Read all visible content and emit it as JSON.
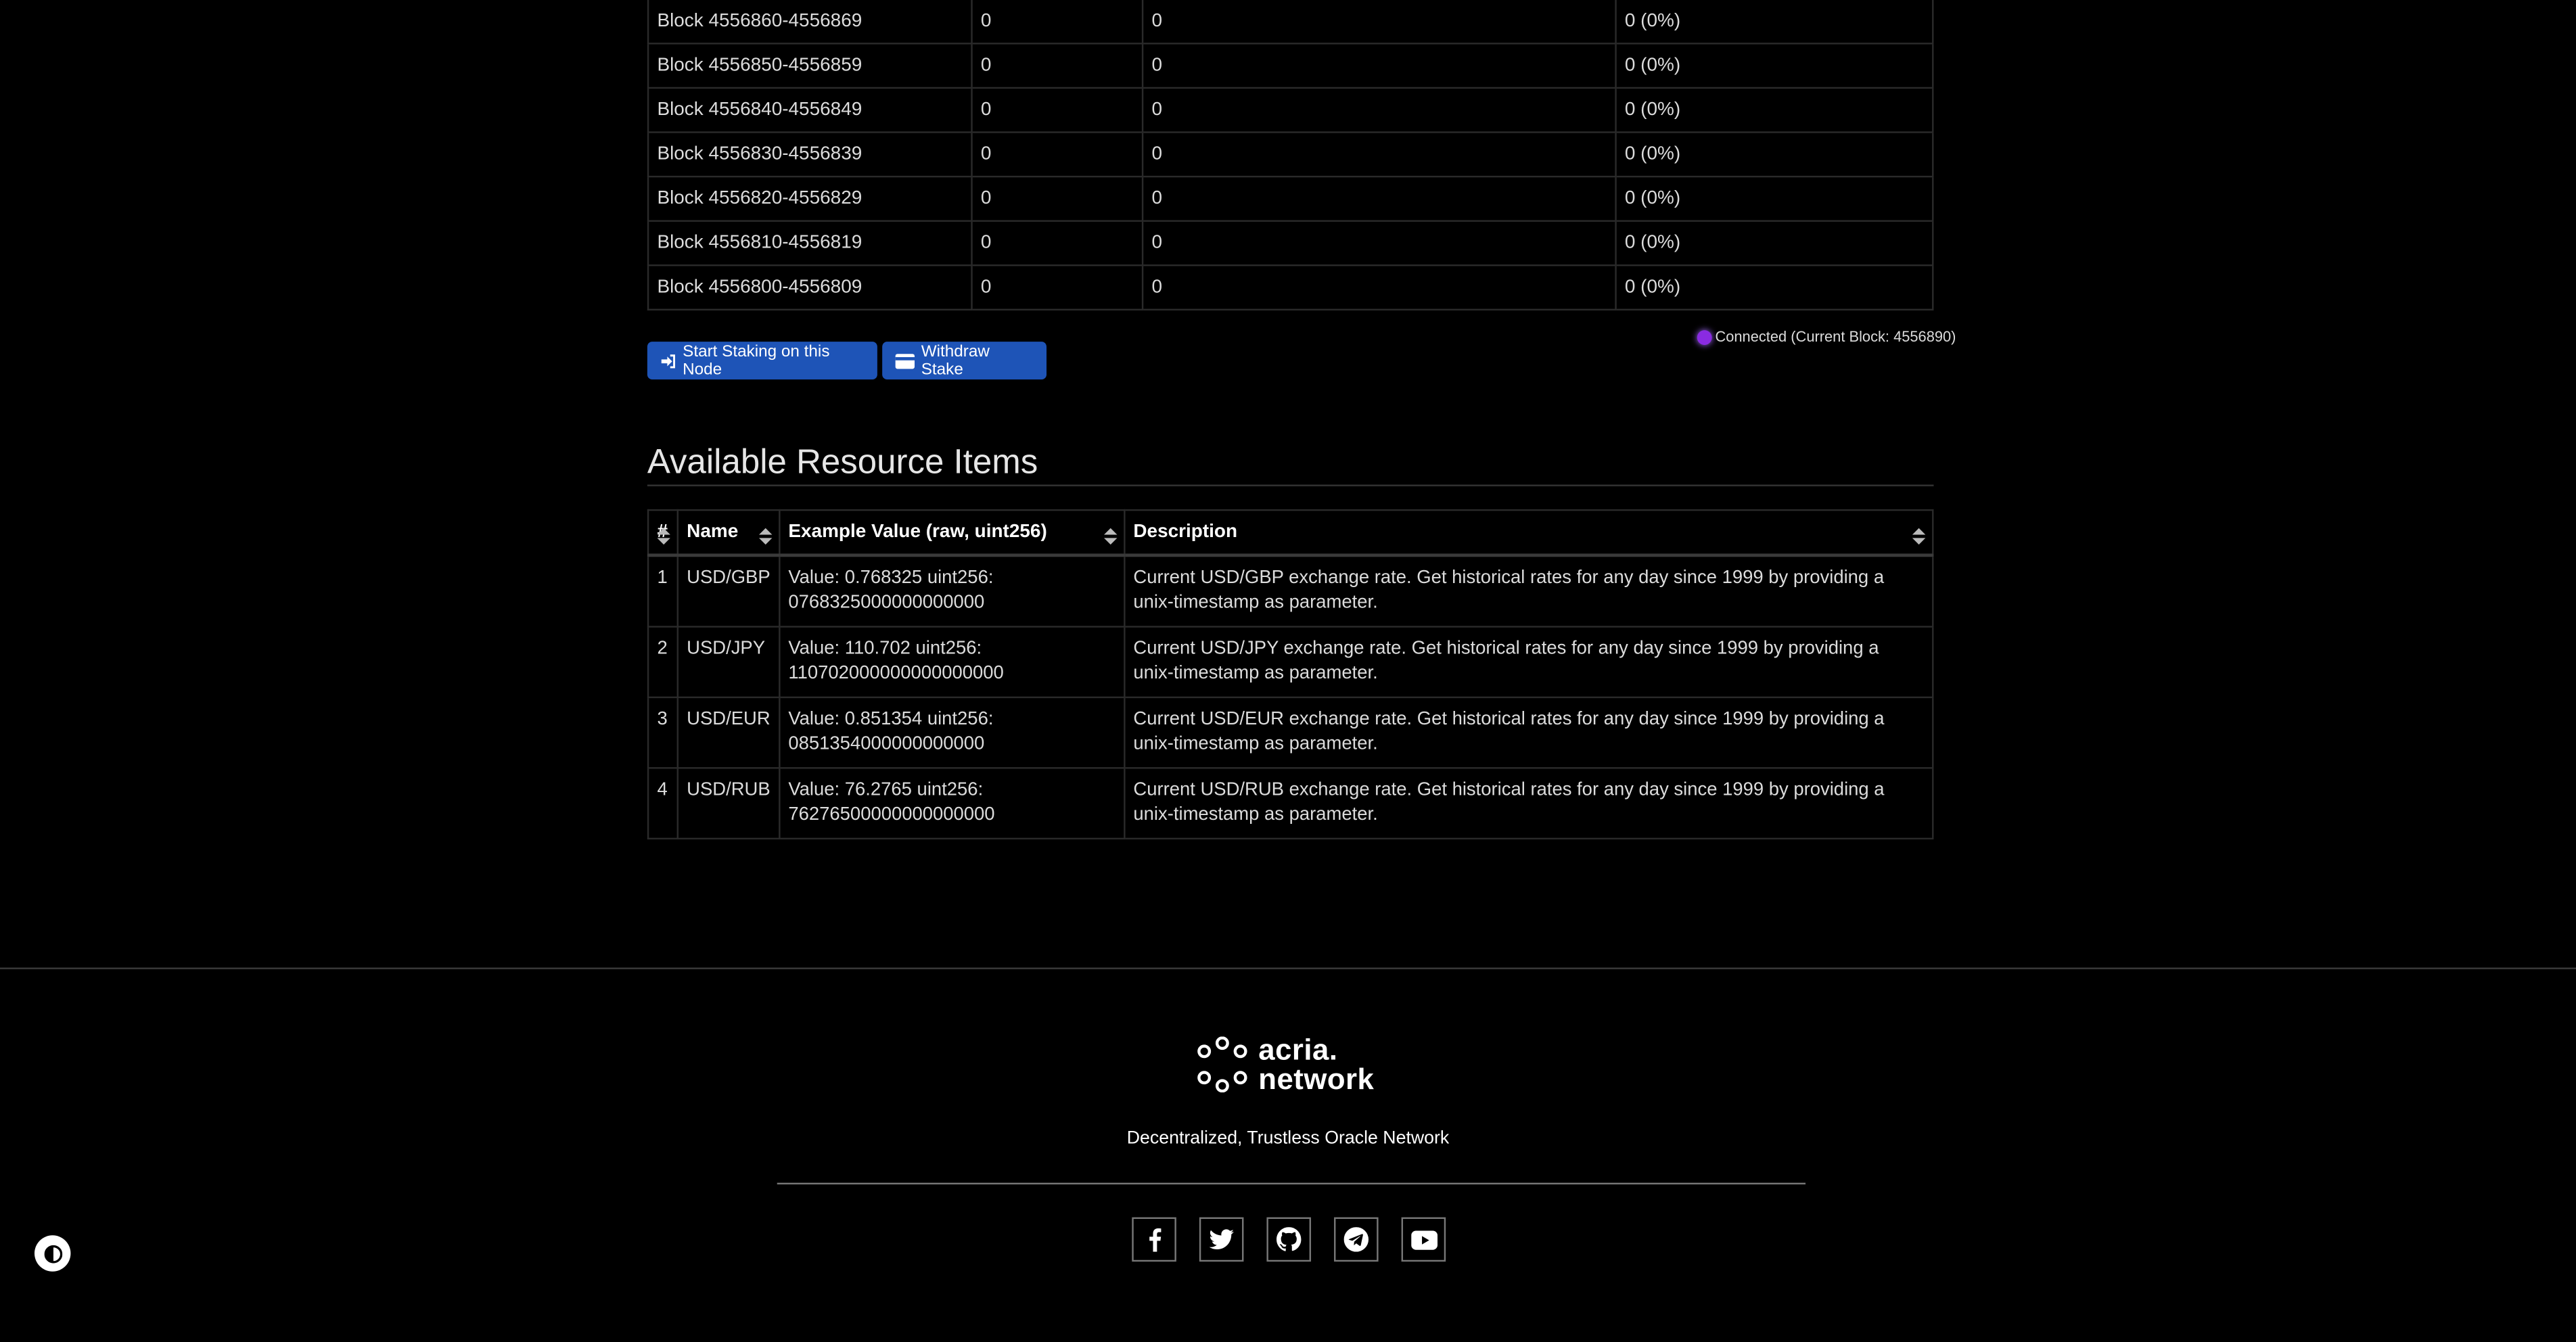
{
  "blocks": {
    "rows": [
      {
        "block": "Block 4556860-4556869",
        "c2": "0",
        "c3": "0",
        "c4": "0 (0%)"
      },
      {
        "block": "Block 4556850-4556859",
        "c2": "0",
        "c3": "0",
        "c4": "0 (0%)"
      },
      {
        "block": "Block 4556840-4556849",
        "c2": "0",
        "c3": "0",
        "c4": "0 (0%)"
      },
      {
        "block": "Block 4556830-4556839",
        "c2": "0",
        "c3": "0",
        "c4": "0 (0%)"
      },
      {
        "block": "Block 4556820-4556829",
        "c2": "0",
        "c3": "0",
        "c4": "0 (0%)"
      },
      {
        "block": "Block 4556810-4556819",
        "c2": "0",
        "c3": "0",
        "c4": "0 (0%)"
      },
      {
        "block": "Block 4556800-4556809",
        "c2": "0",
        "c3": "0",
        "c4": "0 (0%)"
      }
    ]
  },
  "actions": {
    "start_staking": "Start Staking on this Node",
    "withdraw_stake": "Withdraw Stake"
  },
  "status": {
    "text": "Connected (Current Block: 4556890)",
    "color": "#8a2be2"
  },
  "resources": {
    "title": "Available Resource Items",
    "headers": {
      "num": "#",
      "name": "Name",
      "example": "Example Value (raw, uint256)",
      "description": "Description"
    },
    "rows": [
      {
        "num": "1",
        "name": "USD/GBP",
        "example_value": "Value: 0.768325 uint256:",
        "example_raw": "0768325000000000000",
        "description": "Current USD/GBP exchange rate. Get historical rates for any day since 1999 by providing a unix-timestamp as parameter."
      },
      {
        "num": "2",
        "name": "USD/JPY",
        "example_value": "Value: 110.702 uint256:",
        "example_raw": "110702000000000000000",
        "description": "Current USD/JPY exchange rate. Get historical rates for any day since 1999 by providing a unix-timestamp as parameter."
      },
      {
        "num": "3",
        "name": "USD/EUR",
        "example_value": "Value: 0.851354 uint256:",
        "example_raw": "0851354000000000000",
        "description": "Current USD/EUR exchange rate. Get historical rates for any day since 1999 by providing a unix-timestamp as parameter."
      },
      {
        "num": "4",
        "name": "USD/RUB",
        "example_value": "Value: 76.2765 uint256:",
        "example_raw": "76276500000000000000",
        "description": "Current USD/RUB exchange rate. Get historical rates for any day since 1999 by providing a unix-timestamp as parameter."
      }
    ]
  },
  "footer": {
    "logo_line1": "acria.",
    "logo_line2": "network",
    "tagline": "Decentralized, Trustless Oracle Network",
    "social": [
      "facebook-icon",
      "twitter-icon",
      "github-icon",
      "telegram-icon",
      "youtube-icon"
    ]
  },
  "colors": {
    "button": "#1e54b7",
    "background": "#000000"
  }
}
